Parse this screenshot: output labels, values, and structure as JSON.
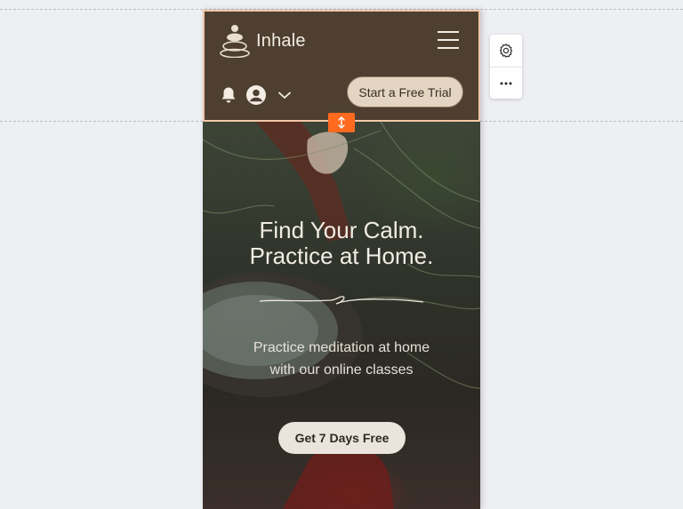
{
  "header": {
    "logo_text": "Inhale",
    "trial_button_label": "Start a Free Trial"
  },
  "hero": {
    "title_line1": "Find Your Calm.",
    "title_line2": "Practice at Home.",
    "subtitle_line1": "Practice meditation at home",
    "subtitle_line2": "with our online classes",
    "cta_label": "Get 7 Days Free"
  },
  "editor": {
    "tools": [
      "settings-icon",
      "more-icon"
    ],
    "handle_icon": "vertical-resize-icon"
  },
  "colors": {
    "header_bg": "#4e3f31",
    "header_border": "#f2c7a8",
    "trial_button_bg": "#e4d5c2",
    "handle_accent": "#ff6a1f",
    "cta_bg": "#eae4dc",
    "canvas_bg": "#eeeff3"
  }
}
